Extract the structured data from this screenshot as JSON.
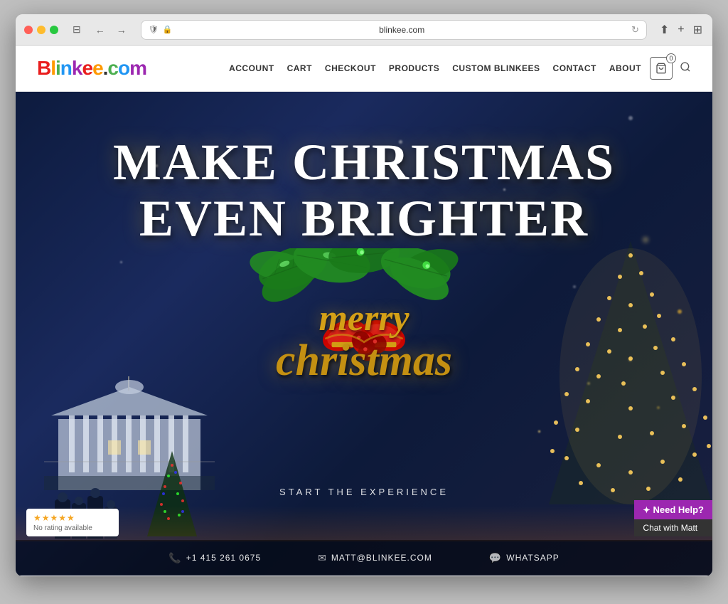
{
  "browser": {
    "url": "blinkee.com",
    "url_display": "🔒 blinkee.com",
    "back_label": "←",
    "forward_label": "→",
    "reload_label": "↻",
    "share_label": "⬆",
    "new_tab_label": "+",
    "grid_label": "⊞"
  },
  "site": {
    "logo": "Blinkee.com",
    "logo_letters": [
      "B",
      "l",
      "i",
      "n",
      "k",
      "e",
      "e",
      ".",
      "c",
      "o",
      "m"
    ],
    "nav": {
      "items": [
        {
          "label": "ACCOUNT",
          "href": "#"
        },
        {
          "label": "CART",
          "href": "#"
        },
        {
          "label": "CHECKOUT",
          "href": "#"
        },
        {
          "label": "PRODUCTS",
          "href": "#"
        },
        {
          "label": "CUSTOM BLINKEES",
          "href": "#"
        },
        {
          "label": "CONTACT",
          "href": "#"
        },
        {
          "label": "ABOUT",
          "href": "#"
        }
      ],
      "cart_count": "0"
    },
    "hero": {
      "headline_line1": "MAKE CHRISTMAS",
      "headline_line2": "EVEN BRIGHTER",
      "merry": "merry",
      "christmas": "christmas",
      "cta": "START THE EXPERIENCE"
    },
    "footer_bar": {
      "phone": "+1 415 261 0675",
      "email": "MATT@BLINKEE.COM",
      "whatsapp": "WHATSAPP"
    },
    "rating": {
      "stars": "★★★★★",
      "text": "No rating available"
    },
    "help_widget": {
      "label": "Need Help?",
      "chat_label": "Chat with Matt"
    }
  }
}
